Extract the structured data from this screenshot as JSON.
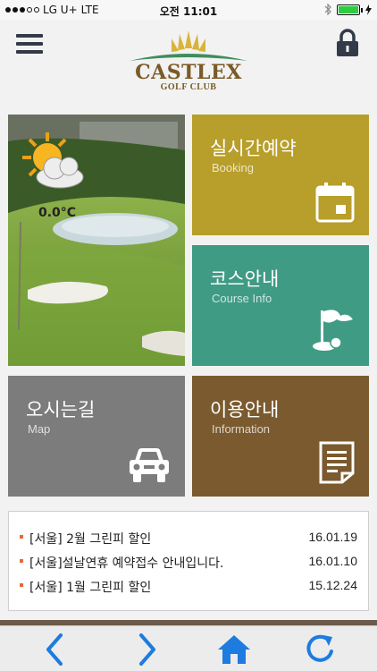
{
  "status_bar": {
    "carrier": "LG U+",
    "network": "LTE",
    "time": "오전 11:01"
  },
  "header": {
    "brand": "CASTLEX",
    "sub": "GOLF CLUB"
  },
  "weather": {
    "temperature": "0.0°C"
  },
  "tiles": [
    {
      "title": "실시간예약",
      "subtitle": "Booking",
      "color": "#b89e2a",
      "icon": "calendar-icon"
    },
    {
      "title": "코스안내",
      "subtitle": "Course Info",
      "color": "#3f9b84",
      "icon": "golf-flag-icon"
    },
    {
      "title": "오시는길",
      "subtitle": "Map",
      "color": "#7c7c7c",
      "icon": "car-icon"
    },
    {
      "title": "이용안내",
      "subtitle": "Information",
      "color": "#7a5a2e",
      "icon": "document-icon"
    }
  ],
  "notices": [
    {
      "text": "[서울] 2월 그린피 할인",
      "date": "16.01.19"
    },
    {
      "text": "[서울]설날연휴 예약접수 안내입니다.",
      "date": "16.01.10"
    },
    {
      "text": "[서울] 1월 그린피 할인",
      "date": "15.12.24"
    }
  ],
  "toolbar": {
    "accent": "#1e7be0",
    "buttons": [
      "back-icon",
      "forward-icon",
      "home-icon",
      "refresh-icon"
    ]
  }
}
